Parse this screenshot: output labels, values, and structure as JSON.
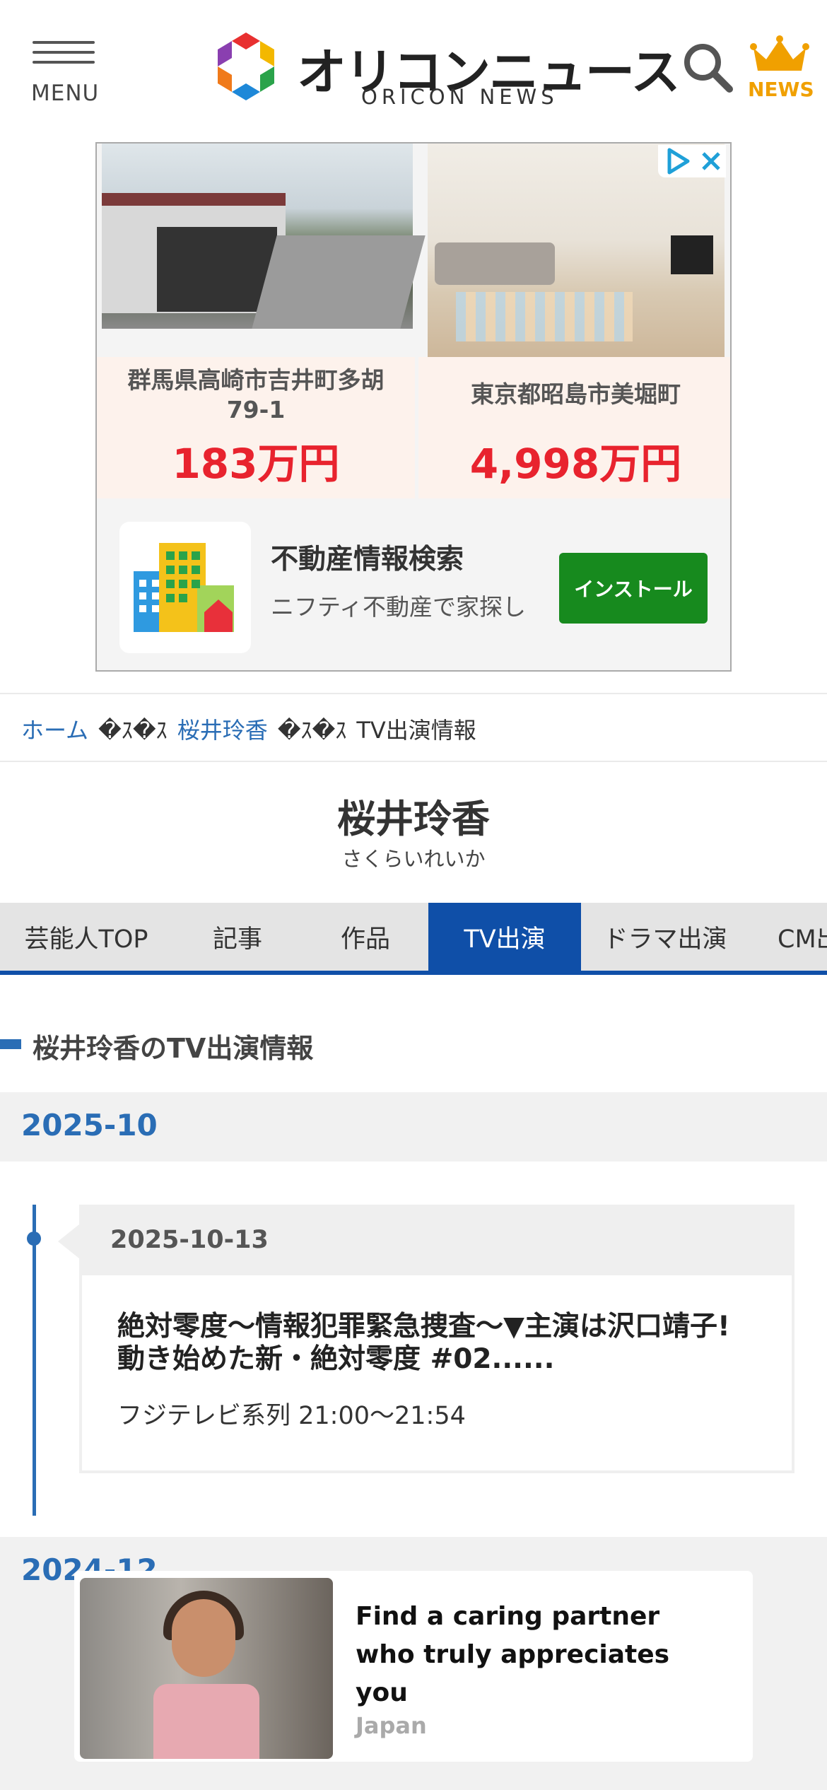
{
  "header": {
    "menu_label": "MENU",
    "logo_text": "オリコンニュース",
    "logo_sub": "ORICON NEWS",
    "news_label": "NEWS"
  },
  "ad": {
    "listing_left": {
      "address": "群馬県高崎市吉井町多胡79-1",
      "price": "183万円"
    },
    "listing_right": {
      "address": "東京都昭島市美堀町",
      "price": "4,998万円"
    },
    "app_title": "不動産情報検索",
    "app_desc": "ニフティ不動産で家探し",
    "install_label": "インストール"
  },
  "breadcrumb": {
    "home": "ホーム",
    "sep": "�ｽ�ｽ",
    "person": "桜井玲香",
    "current": "TV出演情報"
  },
  "person": {
    "name": "桜井玲香",
    "kana": "さくらいれいか"
  },
  "tabs": [
    {
      "label": "芸能人TOP",
      "active": false
    },
    {
      "label": "記事",
      "active": false
    },
    {
      "label": "作品",
      "active": false
    },
    {
      "label": "TV出演",
      "active": true
    },
    {
      "label": "ドラマ出演",
      "active": false
    },
    {
      "label": "CM出演",
      "active": false
    }
  ],
  "section_heading": "桜井玲香のTV出演情報",
  "months": [
    {
      "label": "2025-10",
      "entries": [
        {
          "date": "2025-10-13",
          "title": "絶対零度～情報犯罪緊急捜査～▼主演は沢口靖子!動き始めた新・絶対零度 #02......",
          "info": "フジテレビ系列 21:00～21:54"
        }
      ]
    },
    {
      "label": "2024-12"
    }
  ],
  "sticky_ad": {
    "title": "Find a caring partner who truly appreciates you",
    "source": "Japan"
  },
  "colors": {
    "brand_blue": "#0f4fa8",
    "link_blue": "#2a6db5",
    "price_red": "#e8232e",
    "install_green": "#178a1e",
    "crown_orange": "#f0a000"
  }
}
